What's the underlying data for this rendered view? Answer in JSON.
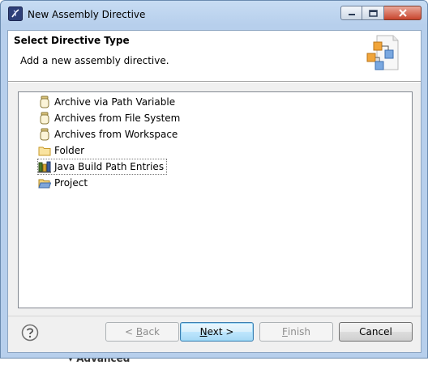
{
  "window": {
    "title": "New Assembly Directive",
    "app_icon": "eclipse-icon",
    "controls": {
      "minimize_icon": "minimize-icon",
      "maximize_icon": "maximize-icon",
      "close_icon": "close-icon"
    }
  },
  "header": {
    "title": "Select Directive Type",
    "message": "Add a new assembly directive.",
    "image_icon": "wizard-banner-icon"
  },
  "directive_types": [
    {
      "label": "Archive via Path Variable",
      "icon": "jar-icon"
    },
    {
      "label": "Archives from File System",
      "icon": "jar-icon"
    },
    {
      "label": "Archives from Workspace",
      "icon": "jar-icon"
    },
    {
      "label": "Folder",
      "icon": "folder-icon"
    },
    {
      "label": "Java Build Path Entries",
      "icon": "library-icon",
      "selected": true
    },
    {
      "label": "Project",
      "icon": "project-folder-icon"
    }
  ],
  "buttons": {
    "help_icon": "help-icon",
    "back": {
      "prefix": "< ",
      "mnemonic": "B",
      "rest": "ack",
      "enabled": false
    },
    "next": {
      "mnemonic": "N",
      "rest": "ext >",
      "enabled": true
    },
    "finish": {
      "mnemonic": "F",
      "rest": "inish",
      "enabled": false
    },
    "cancel": {
      "label": "Cancel",
      "enabled": true
    }
  },
  "background": {
    "partial_text": "Advanced"
  }
}
